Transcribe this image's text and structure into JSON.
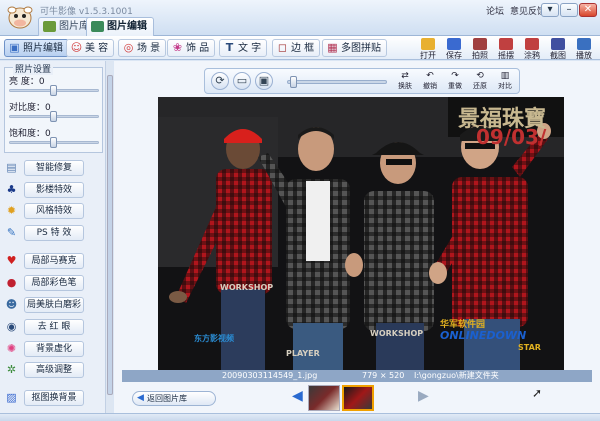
{
  "app": {
    "title": "可牛影像 v1.5.3.1001",
    "tabs": [
      {
        "label": "图片库",
        "active": false
      },
      {
        "label": "图片编辑",
        "active": true
      }
    ],
    "links": {
      "forum": "论坛",
      "feedback": "意见反馈"
    },
    "window_controls": [
      "▾",
      "–",
      "□",
      "✕"
    ]
  },
  "toolbar": {
    "tools": [
      {
        "label": "照片编辑",
        "icon": "photo-edit-icon",
        "glyph": "▣",
        "color": "#3b6fc4",
        "active": true
      },
      {
        "label": "美 容",
        "icon": "beauty-icon",
        "glyph": "☺",
        "color": "#d23a3a",
        "active": false
      },
      {
        "label": "场 景",
        "icon": "scene-icon",
        "glyph": "◎",
        "color": "#d23a3a",
        "active": false
      },
      {
        "label": "饰 品",
        "icon": "accessory-icon",
        "glyph": "❀",
        "color": "#c43a8a",
        "active": false
      },
      {
        "label": "文 字",
        "icon": "text-icon",
        "glyph": "T",
        "color": "#2a4a7a",
        "active": false
      },
      {
        "label": "边 框",
        "icon": "frame-icon",
        "glyph": "◻",
        "color": "#a03030",
        "active": false
      },
      {
        "label": "多图拼贴",
        "icon": "collage-icon",
        "glyph": "▦",
        "color": "#b03050",
        "active": false
      }
    ],
    "right_tools": [
      {
        "label": "打开",
        "icon": "open-icon",
        "color": "#e8b030"
      },
      {
        "label": "保存",
        "icon": "save-icon",
        "color": "#3a6ad0"
      },
      {
        "label": "拍照",
        "icon": "camera-icon",
        "color": "#a04040"
      },
      {
        "label": "摇摆",
        "icon": "shake-icon",
        "color": "#c04040"
      },
      {
        "label": "涂鸦",
        "icon": "doodle-icon",
        "color": "#c04040"
      },
      {
        "label": "截图",
        "icon": "screenshot-icon",
        "color": "#4050a0"
      },
      {
        "label": "播放",
        "icon": "play-icon",
        "color": "#3a70c0"
      }
    ]
  },
  "left_panel": {
    "settings_title": "照片设置",
    "sliders": [
      {
        "label": "亮 度：0",
        "value": 0.5
      },
      {
        "label": "对比度：0",
        "value": 0.5
      },
      {
        "label": "饱和度：0",
        "value": 0.5
      }
    ],
    "effects": [
      {
        "label": "智能修复",
        "icon": "smart-repair-icon",
        "glyph": "▤",
        "color": "#5b7fb0"
      },
      {
        "label": "影楼特效",
        "icon": "studio-effect-icon",
        "glyph": "♣",
        "color": "#1a3a8a"
      },
      {
        "label": "风格特效",
        "icon": "style-effect-icon",
        "glyph": "✹",
        "color": "#e0a020"
      },
      {
        "label": "PS 特 效",
        "icon": "ps-effect-icon",
        "glyph": "✎",
        "color": "#3070c0"
      },
      {
        "label": "局部马赛克",
        "icon": "mosaic-icon",
        "glyph": "♥",
        "color": "#d02020"
      },
      {
        "label": "局部彩色笔",
        "icon": "color-pen-icon",
        "glyph": "●",
        "color": "#c02030"
      },
      {
        "label": "局美肤白磨彩",
        "icon": "skin-beauty-icon",
        "glyph": "☻",
        "color": "#3a6aa0"
      },
      {
        "label": "去 红 眼",
        "icon": "red-eye-icon",
        "glyph": "◉",
        "color": "#2a4a7a"
      },
      {
        "label": "背景虚化",
        "icon": "background-blur-icon",
        "glyph": "✺",
        "color": "#e04080"
      },
      {
        "label": "高级调整",
        "icon": "advanced-adjust-icon",
        "glyph": "✲",
        "color": "#3a8a3a"
      },
      {
        "label": "抠图换背景",
        "icon": "cutout-icon",
        "glyph": "▨",
        "color": "#3a6ad0"
      }
    ]
  },
  "viewer": {
    "view_buttons": [
      {
        "icon": "rotate-icon",
        "glyph": "⟳"
      },
      {
        "icon": "fit-screen-icon",
        "glyph": "▭"
      },
      {
        "icon": "actual-size-icon",
        "glyph": "▣"
      }
    ],
    "zoom_value": 0.02,
    "actions": [
      {
        "label": "换肤",
        "glyph": "⇄"
      },
      {
        "label": "撤销",
        "glyph": "↶"
      },
      {
        "label": "重做",
        "glyph": "↷"
      },
      {
        "label": "还原",
        "glyph": "⟲"
      },
      {
        "label": "对比",
        "glyph": "▥"
      }
    ],
    "photo_text": {
      "banner_right": "景福珠寶",
      "banner_date": "09/03/",
      "tags": [
        "WORKSHOP",
        "PLAYER",
        "WORKSHOP"
      ],
      "watermark_left": "东方影视频",
      "watermark_right": "ONLINEDOWN",
      "watermark_right_sub": "华军软件园",
      "watermark_star": "STAR"
    },
    "info": {
      "filename": "20090303114549_1.jpg",
      "dimensions": "779 × 520",
      "path": "I:\\gongzuo\\新建文件夹"
    },
    "back_label": "返回图片库"
  }
}
